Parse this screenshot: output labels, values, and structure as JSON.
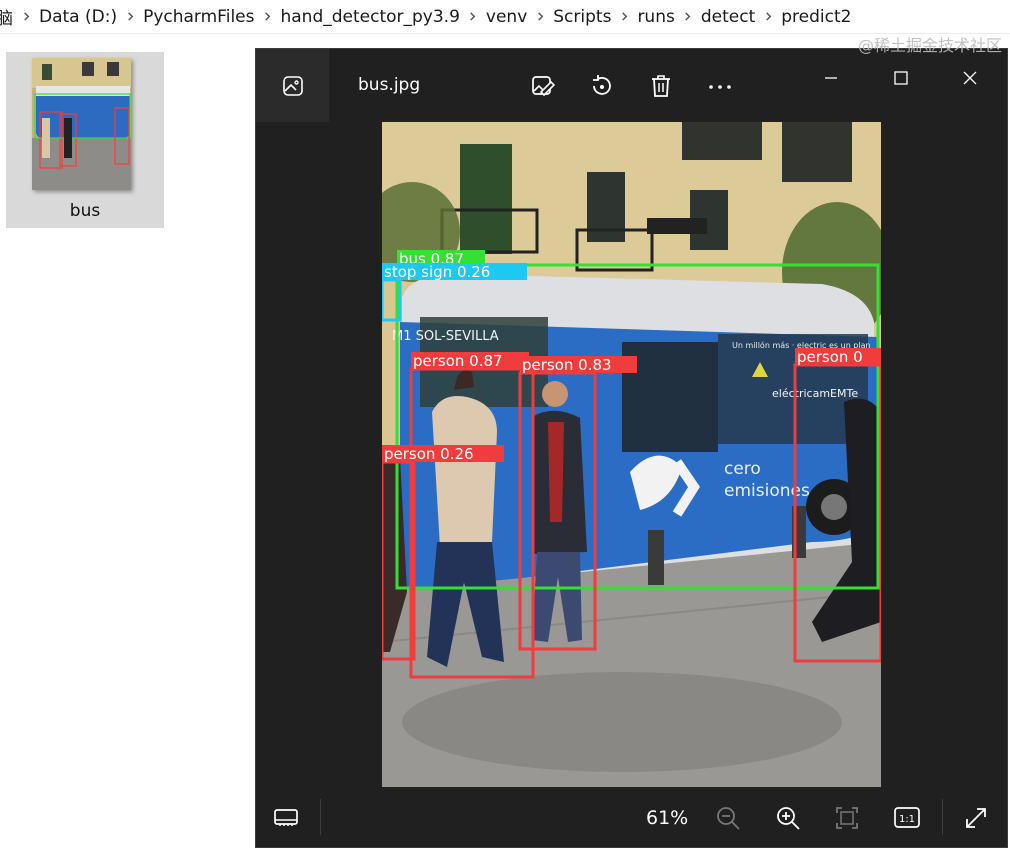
{
  "breadcrumb": {
    "items": [
      "脑",
      "Data (D:)",
      "PycharmFiles",
      "hand_detector_py3.9",
      "venv",
      "Scripts",
      "runs",
      "detect",
      "predict2"
    ]
  },
  "file": {
    "name": "bus"
  },
  "viewer": {
    "title": "bus.jpg",
    "toolbar_icons": [
      "edit-image-icon",
      "rotate-icon",
      "delete-icon",
      "more-icon"
    ],
    "window_controls": [
      "minimize-icon",
      "maximize-icon",
      "close-icon"
    ],
    "zoom_level": "61%",
    "bottom_icons": [
      "filmstrip-icon",
      "zoom-out-icon",
      "zoom-in-icon",
      "fit-to-window-icon",
      "actual-size-icon",
      "fullscreen-icon"
    ],
    "actual_size_label": "1:1"
  },
  "photo": {
    "bus_side_text": "cero emisiones",
    "bus_brand_text": "eléctricamEMTe",
    "bus_route_text": "M1 SOL-SEVILLA",
    "detections": [
      {
        "label": "bus",
        "score": "0.87",
        "text": "bus 0.87",
        "color": "#33e033"
      },
      {
        "label": "stop sign",
        "score": "0.26",
        "text": "stop sign 0.26",
        "color": "#1ec8f0"
      },
      {
        "label": "person",
        "score": "0.87",
        "text": "person 0.87",
        "color": "#f03c3c"
      },
      {
        "label": "person",
        "score": "0.83",
        "text": "person 0.83",
        "color": "#f03c3c"
      },
      {
        "label": "person",
        "score": "0.26",
        "text": "person 0.26",
        "color": "#f03c3c"
      },
      {
        "label": "person",
        "score": "0",
        "text": "person 0",
        "color": "#f03c3c"
      }
    ]
  },
  "watermark": "@稀土掘金技术社区"
}
